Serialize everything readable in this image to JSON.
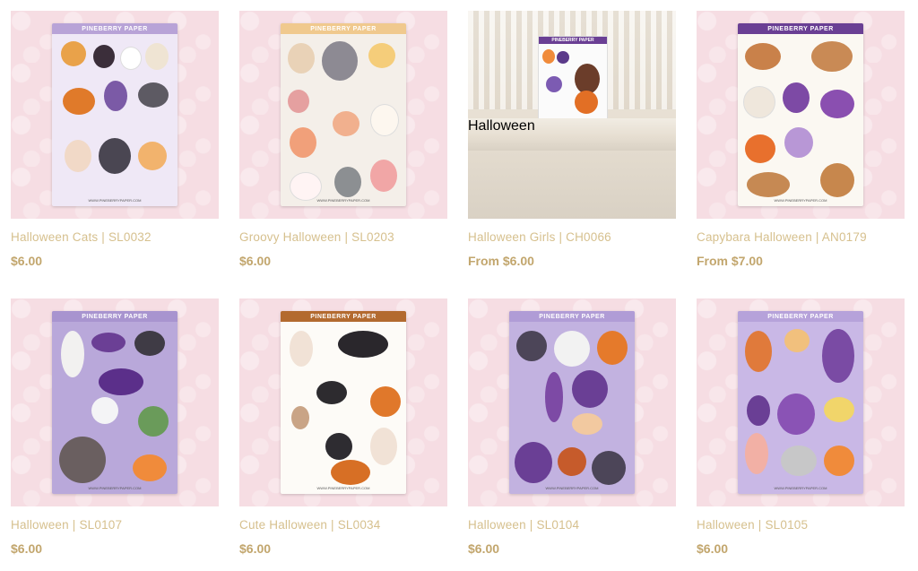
{
  "products": [
    {
      "title": "Halloween Cats | SL0032",
      "price": "$6.00",
      "sheet_label": "PINEBERRY PAPER",
      "sheet_color": "#c9b6e4",
      "band_color": "#b8a3d7"
    },
    {
      "title": "Groovy Halloween | SL0203",
      "price": "$6.00",
      "sheet_label": "PINEBERRY PAPER",
      "sheet_color": "#f4efe9",
      "band_color": "#f0c98e"
    },
    {
      "title": "Halloween Girls | CH0066",
      "price": "From $6.00",
      "banner": "Halloween",
      "sheet_label": "PINEBERRY PAPER"
    },
    {
      "title": "Capybara Halloween | AN0179",
      "price": "From $7.00",
      "sheet_label": "PINEBERRY PAPER",
      "sheet_color": "#fbf8f2",
      "band_color": "#6a3f94"
    },
    {
      "title": "Halloween | SL0107",
      "price": "$6.00",
      "sheet_label": "PINEBERRY PAPER",
      "sheet_color": "#b9a8da",
      "band_color": "#a894cf"
    },
    {
      "title": "Cute Halloween | SL0034",
      "price": "$6.00",
      "sheet_label": "PINEBERRY PAPER",
      "sheet_color": "#fdfbf7",
      "band_color": "#b36a2f"
    },
    {
      "title": "Halloween | SL0104",
      "price": "$6.00",
      "sheet_label": "PINEBERRY PAPER",
      "sheet_color": "#c2b2e0",
      "band_color": "#b09cd6"
    },
    {
      "title": "Halloween | SL0105",
      "price": "$6.00",
      "sheet_label": "PINEBERRY PAPER",
      "sheet_color": "#c9b8e6",
      "band_color": "#b6a2da"
    }
  ],
  "sheet_footer": "WWW.PINEBERRYPAPER.COM"
}
